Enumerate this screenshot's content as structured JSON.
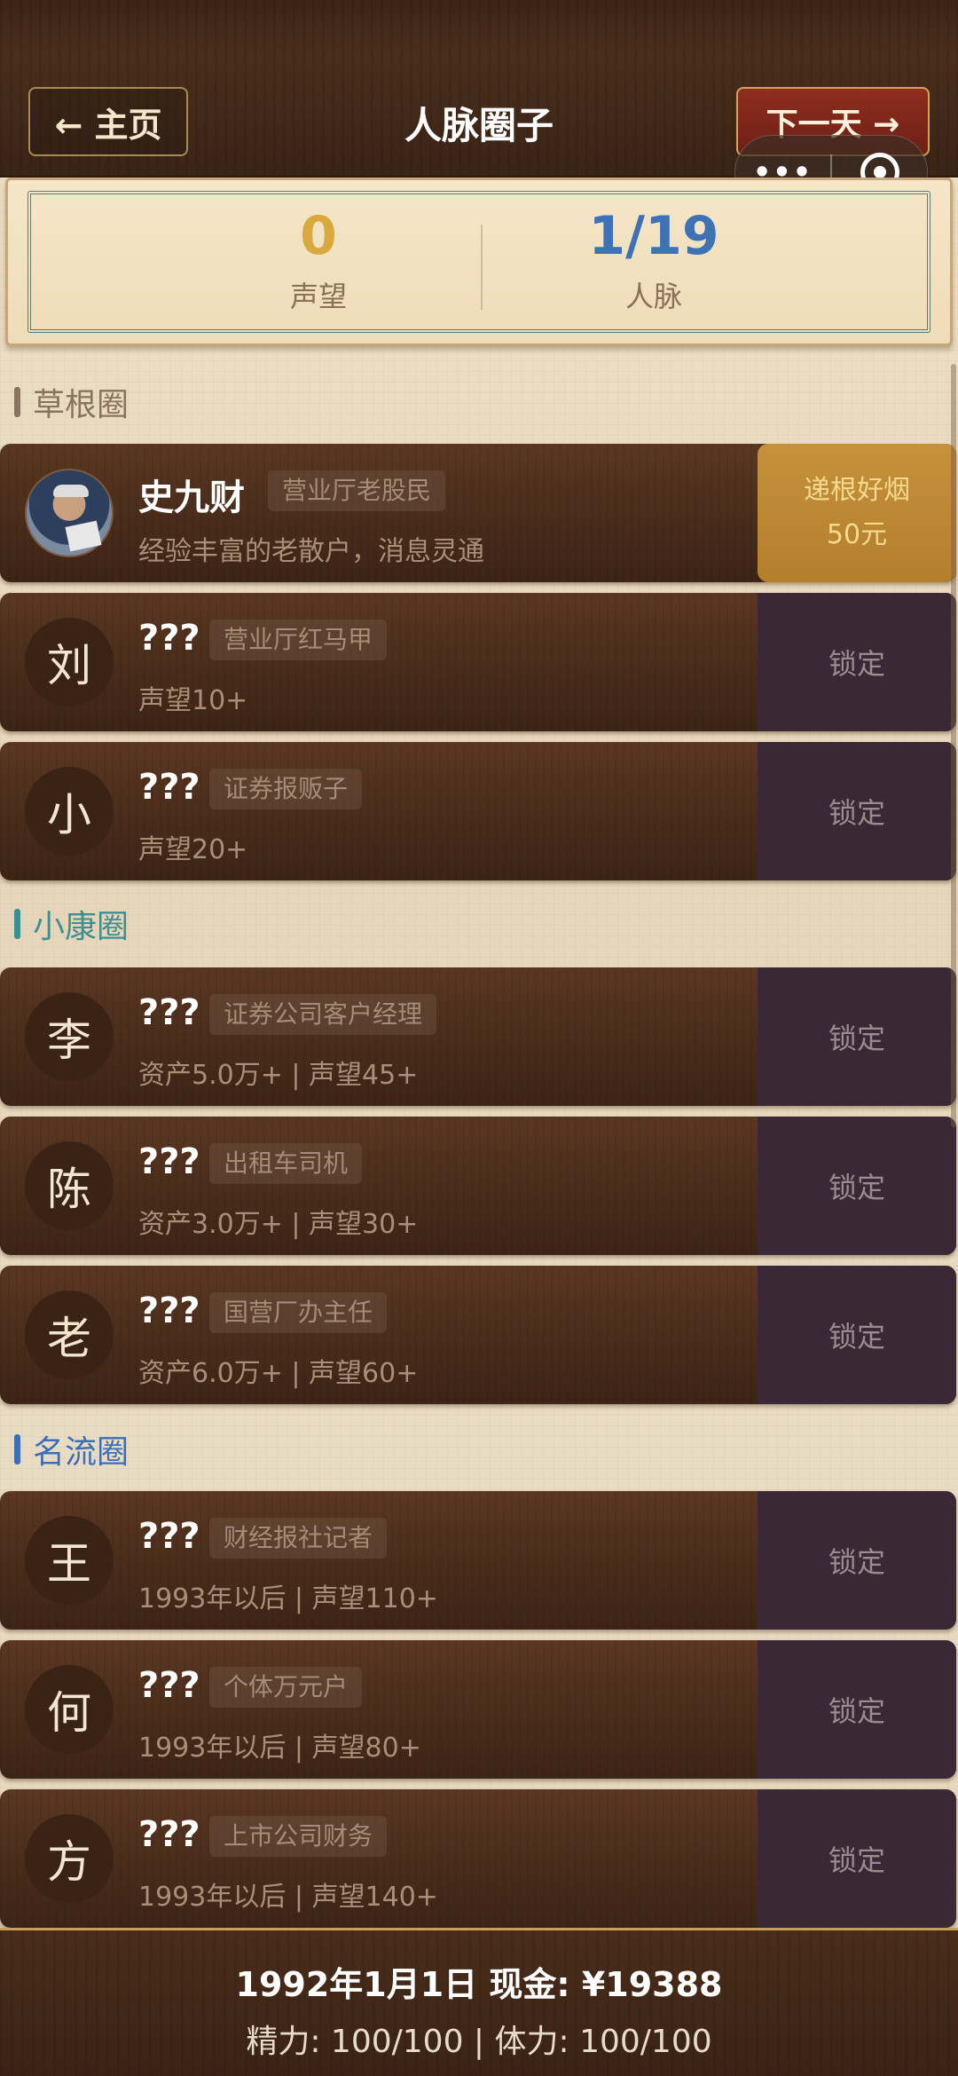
{
  "header": {
    "home_label": "← 主页",
    "title": "人脉圈子",
    "next_label": "下一天 →",
    "capsule_more": "•••"
  },
  "stats": {
    "reputation_value": "0",
    "reputation_label": "声望",
    "network_value": "1/19",
    "network_label": "人脉"
  },
  "sections": [
    {
      "title": "草根圈",
      "contacts": [
        {
          "avatar": "",
          "name": "史九财",
          "role": "营业厅老股民",
          "desc": "经验丰富的老散户，消息灵通",
          "action_line1": "递根好烟",
          "action_line2": "50元",
          "unlocked": true
        },
        {
          "avatar": "刘",
          "name": "???",
          "role": "营业厅红马甲",
          "desc": "声望10+",
          "action": "锁定"
        },
        {
          "avatar": "小",
          "name": "???",
          "role": "证券报贩子",
          "desc": "声望20+",
          "action": "锁定"
        }
      ]
    },
    {
      "title": "小康圈",
      "contacts": [
        {
          "avatar": "李",
          "name": "???",
          "role": "证券公司客户经理",
          "desc": "资产5.0万+ | 声望45+",
          "action": "锁定"
        },
        {
          "avatar": "陈",
          "name": "???",
          "role": "出租车司机",
          "desc": "资产3.0万+ | 声望30+",
          "action": "锁定"
        },
        {
          "avatar": "老",
          "name": "???",
          "role": "国营厂办主任",
          "desc": "资产6.0万+ | 声望60+",
          "action": "锁定"
        }
      ]
    },
    {
      "title": "名流圈",
      "contacts": [
        {
          "avatar": "王",
          "name": "???",
          "role": "财经报社记者",
          "desc": "1993年以后 | 声望110+",
          "action": "锁定"
        },
        {
          "avatar": "何",
          "name": "???",
          "role": "个体万元户",
          "desc": "1993年以后 | 声望80+",
          "action": "锁定"
        },
        {
          "avatar": "方",
          "name": "???",
          "role": "上市公司财务",
          "desc": "1993年以后 | 声望140+",
          "action": "锁定"
        }
      ]
    }
  ],
  "footer": {
    "date_cash": "1992年1月1日  现金: ¥19388",
    "energy_stamina": "精力: 100/100 | 体力: 100/100"
  }
}
